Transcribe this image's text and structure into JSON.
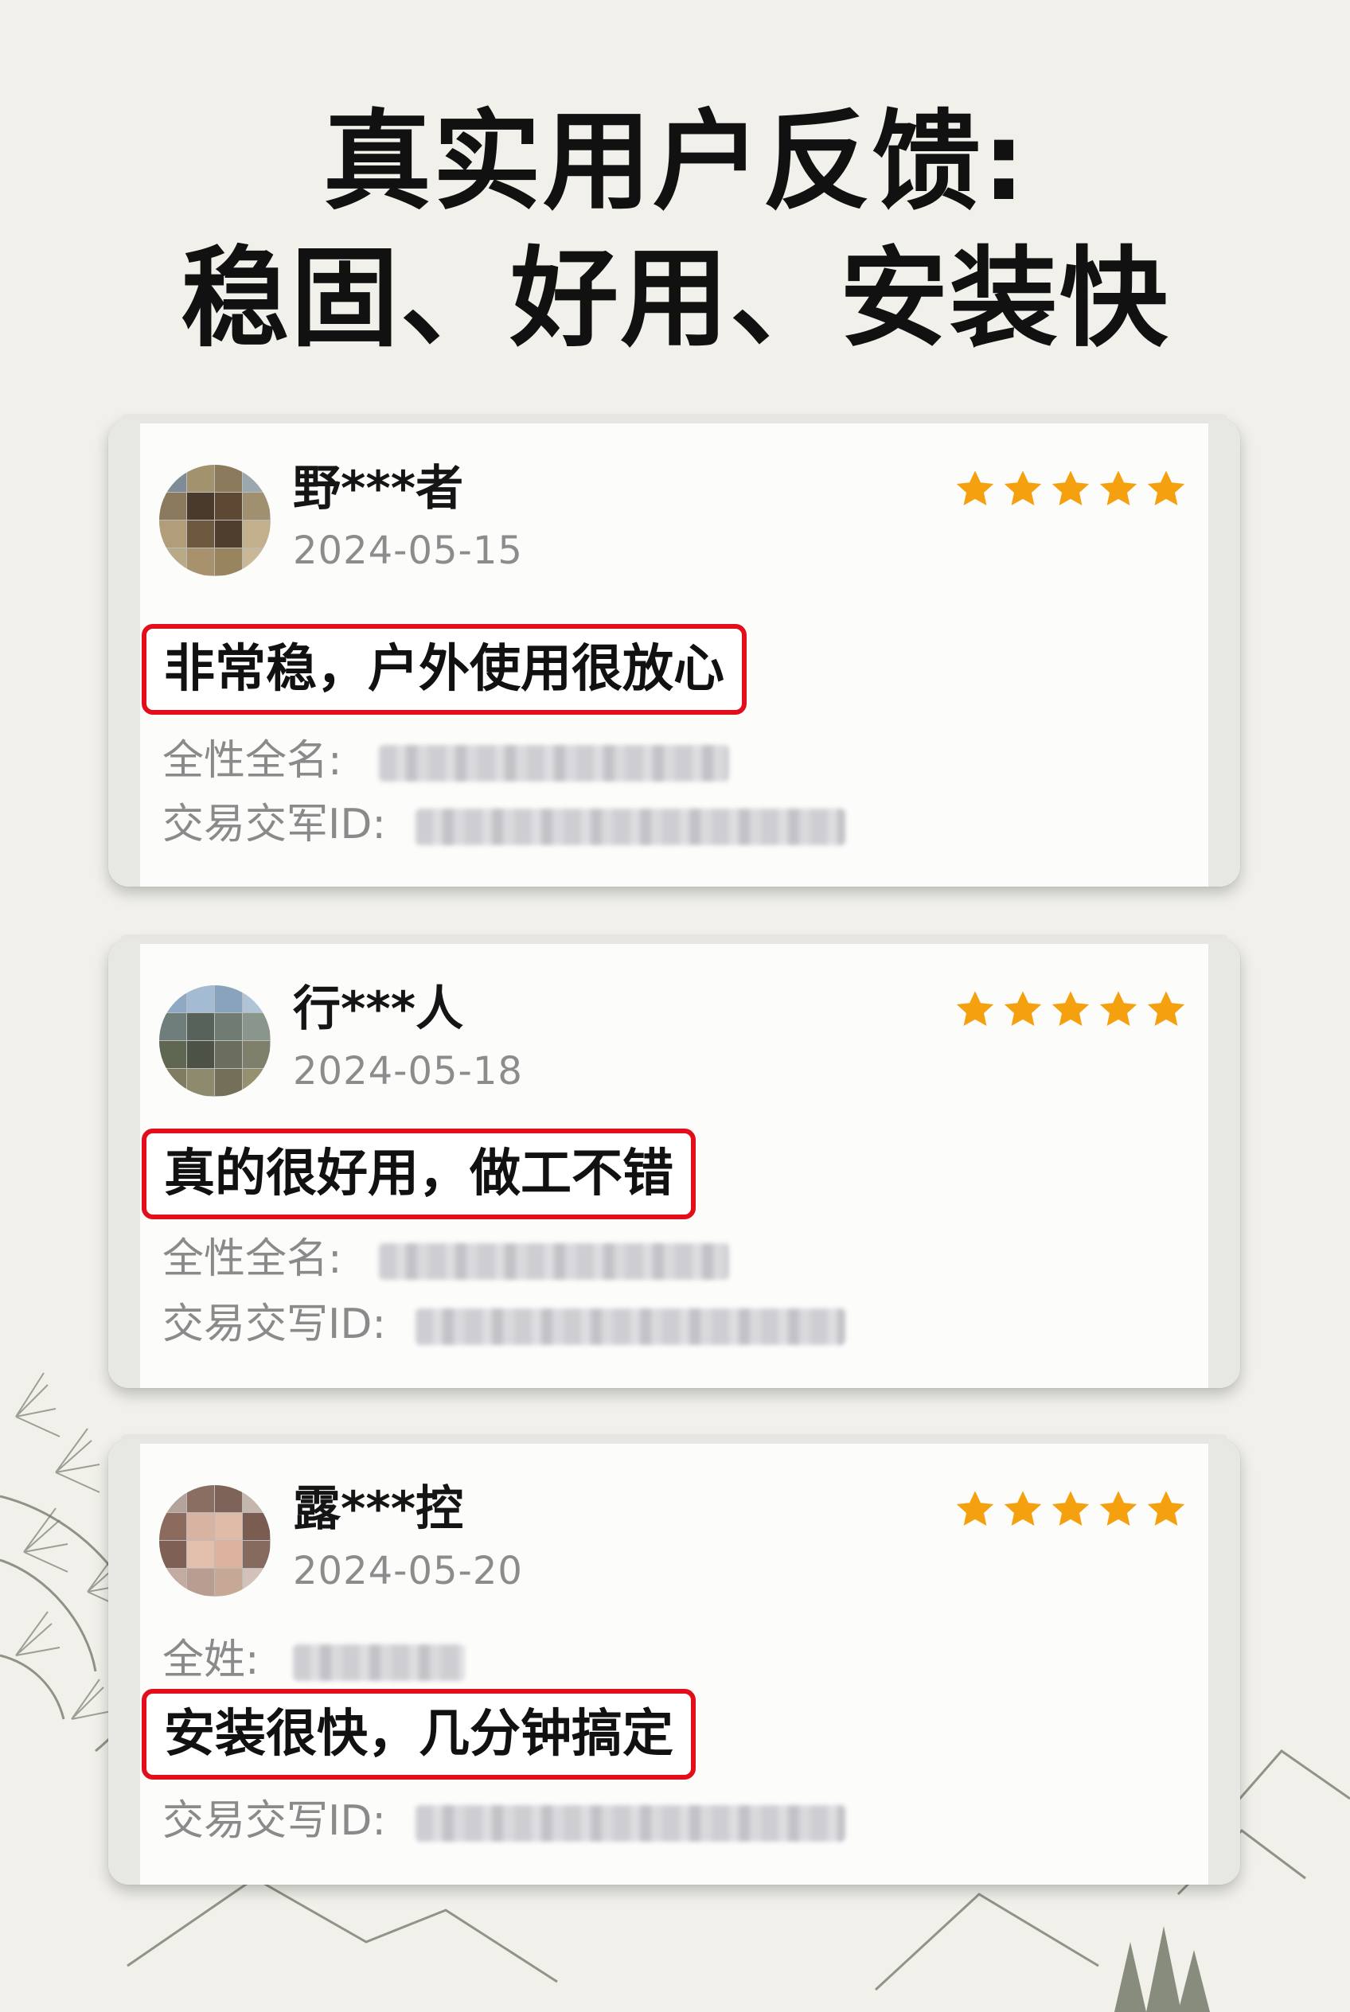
{
  "headline": {
    "line1": "真实用户反馈:",
    "line2": "稳固、好用、安装快"
  },
  "reviews": [
    {
      "user": "野***者",
      "date": "2024-05-15",
      "rating": 5,
      "comment": "非常稳，户外使用很放心",
      "field1_label": "全性全名:",
      "field2_label": "交易交军ID:"
    },
    {
      "user": "行***人",
      "date": "2024-05-18",
      "rating": 5,
      "comment": "真的很好用，做工不错",
      "field1_label": "全性全名:",
      "field2_label": "交易交写ID:"
    },
    {
      "user": "露***控",
      "date": "2024-05-20",
      "rating": 5,
      "comment": "安装很快，几分钟搞定",
      "field1_label": "全姓:",
      "field2_label": "交易交写ID:"
    }
  ],
  "colors": {
    "star": "#f5a10f",
    "highlight_border": "#e20e1b",
    "background": "#f1f0ea"
  }
}
